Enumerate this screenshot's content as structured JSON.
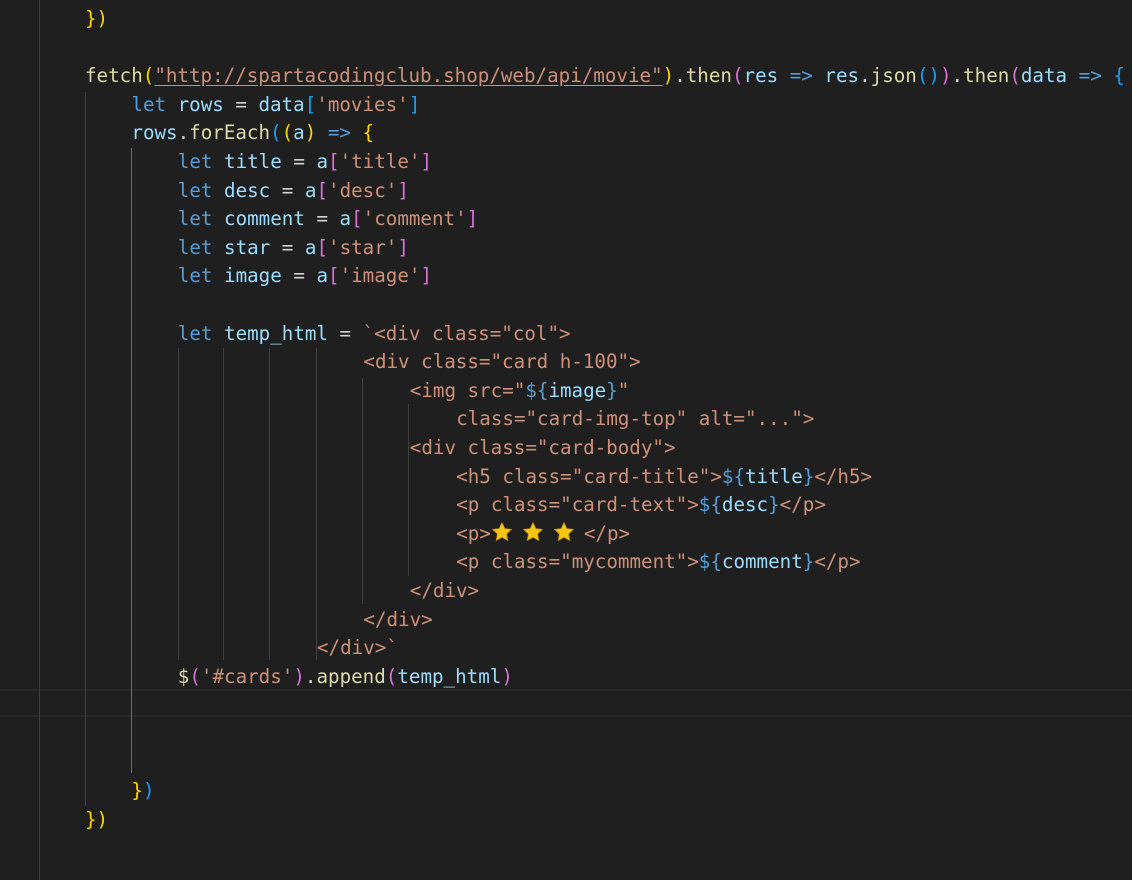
{
  "editor": {
    "lines": [
      {
        "indent": 0,
        "tokens": [
          [
            "t-p1",
            "})"
          ]
        ]
      },
      {
        "indent": 0,
        "tokens": []
      },
      {
        "indent": 0,
        "tokens": [
          [
            "t-fn",
            "fetch"
          ],
          [
            "t-p1",
            "("
          ],
          [
            "t-url",
            "\"http://spartacodingclub.shop/web/api/movie\""
          ],
          [
            "t-p1",
            ")"
          ],
          [
            "t-op",
            "."
          ],
          [
            "t-fn",
            "then"
          ],
          [
            "t-p2",
            "("
          ],
          [
            "t-var",
            "res"
          ],
          [
            "t-op",
            " "
          ],
          [
            "t-kw",
            "=>"
          ],
          [
            "t-op",
            " "
          ],
          [
            "t-var",
            "res"
          ],
          [
            "t-op",
            "."
          ],
          [
            "t-fn",
            "json"
          ],
          [
            "t-p3",
            "()"
          ],
          [
            "t-p2",
            ")"
          ],
          [
            "t-op",
            "."
          ],
          [
            "t-fn",
            "then"
          ],
          [
            "t-p2",
            "("
          ],
          [
            "t-var",
            "data"
          ],
          [
            "t-op",
            " "
          ],
          [
            "t-kw",
            "=>"
          ],
          [
            "t-op",
            " "
          ],
          [
            "t-p3",
            "{"
          ]
        ]
      },
      {
        "indent": 4,
        "tokens": [
          [
            "t-kw",
            "let"
          ],
          [
            "t-op",
            " "
          ],
          [
            "t-var",
            "rows"
          ],
          [
            "t-op",
            " = "
          ],
          [
            "t-var",
            "data"
          ],
          [
            "t-p3",
            "["
          ],
          [
            "t-str",
            "'movies'"
          ],
          [
            "t-p3",
            "]"
          ]
        ]
      },
      {
        "indent": 4,
        "tokens": [
          [
            "t-var",
            "rows"
          ],
          [
            "t-op",
            "."
          ],
          [
            "t-fn",
            "forEach"
          ],
          [
            "t-p3",
            "("
          ],
          [
            "t-p1",
            "("
          ],
          [
            "t-var",
            "a"
          ],
          [
            "t-p1",
            ")"
          ],
          [
            "t-op",
            " "
          ],
          [
            "t-kw",
            "=>"
          ],
          [
            "t-op",
            " "
          ],
          [
            "t-p1",
            "{"
          ]
        ]
      },
      {
        "indent": 8,
        "tokens": [
          [
            "t-kw",
            "let"
          ],
          [
            "t-op",
            " "
          ],
          [
            "t-var",
            "title"
          ],
          [
            "t-op",
            " = "
          ],
          [
            "t-var",
            "a"
          ],
          [
            "t-p2",
            "["
          ],
          [
            "t-str",
            "'title'"
          ],
          [
            "t-p2",
            "]"
          ]
        ]
      },
      {
        "indent": 8,
        "tokens": [
          [
            "t-kw",
            "let"
          ],
          [
            "t-op",
            " "
          ],
          [
            "t-var",
            "desc"
          ],
          [
            "t-op",
            " = "
          ],
          [
            "t-var",
            "a"
          ],
          [
            "t-p2",
            "["
          ],
          [
            "t-str",
            "'desc'"
          ],
          [
            "t-p2",
            "]"
          ]
        ]
      },
      {
        "indent": 8,
        "tokens": [
          [
            "t-kw",
            "let"
          ],
          [
            "t-op",
            " "
          ],
          [
            "t-var",
            "comment"
          ],
          [
            "t-op",
            " = "
          ],
          [
            "t-var",
            "a"
          ],
          [
            "t-p2",
            "["
          ],
          [
            "t-str",
            "'comment'"
          ],
          [
            "t-p2",
            "]"
          ]
        ]
      },
      {
        "indent": 8,
        "tokens": [
          [
            "t-kw",
            "let"
          ],
          [
            "t-op",
            " "
          ],
          [
            "t-var",
            "star"
          ],
          [
            "t-op",
            " = "
          ],
          [
            "t-var",
            "a"
          ],
          [
            "t-p2",
            "["
          ],
          [
            "t-str",
            "'star'"
          ],
          [
            "t-p2",
            "]"
          ]
        ]
      },
      {
        "indent": 8,
        "tokens": [
          [
            "t-kw",
            "let"
          ],
          [
            "t-op",
            " "
          ],
          [
            "t-var",
            "image"
          ],
          [
            "t-op",
            " = "
          ],
          [
            "t-var",
            "a"
          ],
          [
            "t-p2",
            "["
          ],
          [
            "t-str",
            "'image'"
          ],
          [
            "t-p2",
            "]"
          ]
        ]
      },
      {
        "indent": 0,
        "tokens": []
      },
      {
        "indent": 8,
        "tokens": [
          [
            "t-kw",
            "let"
          ],
          [
            "t-op",
            " "
          ],
          [
            "t-var",
            "temp_html"
          ],
          [
            "t-op",
            " = "
          ],
          [
            "t-tag",
            "`<div class=\"col\">"
          ]
        ]
      },
      {
        "indent": 24,
        "tokens": [
          [
            "t-tag",
            "<div class=\"card h-100\">"
          ]
        ]
      },
      {
        "indent": 28,
        "tokens": [
          [
            "t-tag",
            "<img src=\""
          ],
          [
            "t-tpl",
            "${"
          ],
          [
            "t-tvar",
            "image"
          ],
          [
            "t-tpl",
            "}"
          ],
          [
            "t-tag",
            "\""
          ]
        ]
      },
      {
        "indent": 32,
        "tokens": [
          [
            "t-tag",
            "class=\"card-img-top\" alt=\"...\">"
          ]
        ]
      },
      {
        "indent": 28,
        "tokens": [
          [
            "t-tag",
            "<div class=\"card-body\">"
          ]
        ]
      },
      {
        "indent": 32,
        "tokens": [
          [
            "t-tag",
            "<h5 class=\"card-title\">"
          ],
          [
            "t-tpl",
            "${"
          ],
          [
            "t-tvar",
            "title"
          ],
          [
            "t-tpl",
            "}"
          ],
          [
            "t-tag",
            "</h5>"
          ]
        ]
      },
      {
        "indent": 32,
        "tokens": [
          [
            "t-tag",
            "<p class=\"card-text\">"
          ],
          [
            "t-tpl",
            "${"
          ],
          [
            "t-tvar",
            "desc"
          ],
          [
            "t-tpl",
            "}"
          ],
          [
            "t-tag",
            "</p>"
          ]
        ]
      },
      {
        "indent": 32,
        "tokens": [
          [
            "t-tag",
            "<p>"
          ],
          [
            "star",
            "3"
          ],
          [
            "t-tag",
            "</p>"
          ]
        ]
      },
      {
        "indent": 32,
        "tokens": [
          [
            "t-tag",
            "<p class=\"mycomment\">"
          ],
          [
            "t-tpl",
            "${"
          ],
          [
            "t-tvar",
            "comment"
          ],
          [
            "t-tpl",
            "}"
          ],
          [
            "t-tag",
            "</p>"
          ]
        ]
      },
      {
        "indent": 28,
        "tokens": [
          [
            "t-tag",
            "</div>"
          ]
        ]
      },
      {
        "indent": 24,
        "tokens": [
          [
            "t-tag",
            "</div>"
          ]
        ]
      },
      {
        "indent": 20,
        "tokens": [
          [
            "t-tag",
            "</div>`"
          ]
        ]
      },
      {
        "indent": 8,
        "tokens": [
          [
            "t-fn",
            "$"
          ],
          [
            "t-p2",
            "("
          ],
          [
            "t-str",
            "'#cards'"
          ],
          [
            "t-p2",
            ")"
          ],
          [
            "t-op",
            "."
          ],
          [
            "t-fn",
            "append"
          ],
          [
            "t-p2",
            "("
          ],
          [
            "t-var",
            "temp_html"
          ],
          [
            "t-p2",
            ")"
          ]
        ]
      },
      {
        "indent": 0,
        "tokens": []
      },
      {
        "indent": 0,
        "tokens": []
      },
      {
        "indent": 0,
        "tokens": []
      },
      {
        "indent": 4,
        "tokens": [
          [
            "t-p1",
            "}"
          ],
          [
            "t-p3",
            ")"
          ]
        ]
      },
      {
        "indent": 0,
        "tokens": [
          [
            "t-p1",
            "})"
          ]
        ]
      }
    ]
  },
  "colors": {
    "background": "#1f1f1f",
    "keyword": "#569cd6",
    "variable": "#9cdcfe",
    "function": "#dcdcaa",
    "string": "#ce9178",
    "bracket_gold": "#ffd700",
    "bracket_purple": "#da70d6",
    "bracket_blue": "#179fff",
    "star": "#f5c518"
  },
  "icons": {
    "rating": "star-icon"
  }
}
